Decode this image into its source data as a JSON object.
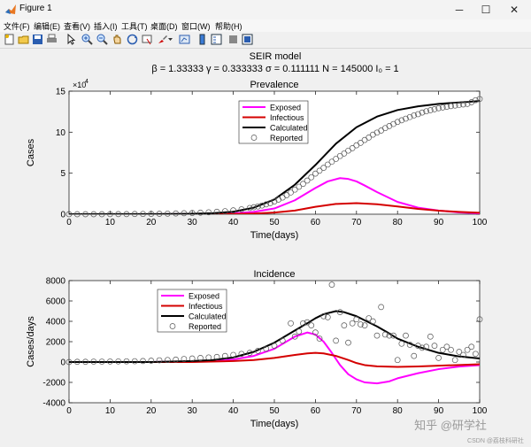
{
  "window": {
    "title": "Figure 1",
    "minimize_glyph": "─",
    "maximize_glyph": "☐",
    "close_glyph": "✕"
  },
  "menu": [
    "文件(F)",
    "编辑(E)",
    "查看(V)",
    "插入(I)",
    "工具(T)",
    "桌面(D)",
    "窗口(W)",
    "帮助(H)"
  ],
  "toolbar_icons": [
    "new-figure-icon",
    "open-file-icon",
    "save-icon",
    "print-icon",
    "select-arrow-icon",
    "zoom-in-icon",
    "zoom-out-icon",
    "pan-icon",
    "rotate-3d-icon",
    "data-cursor-icon",
    "brush-icon",
    "brush-dropdown-icon",
    "link-plot-icon",
    "insert-colorbar-icon",
    "insert-legend-icon",
    "hide-plot-tools-icon",
    "show-plot-tools-icon"
  ],
  "figure": {
    "title": "SEIR model",
    "subtitle": "β = 1.33333  γ = 0.333333  σ = 0.111111  N = 145000  I₀ = 1"
  },
  "watermark": {
    "text": "知乎 @研学社",
    "credit": "CSDN @荔枝科研社"
  },
  "colors": {
    "exposed": "#ff00ff",
    "infectious": "#d40000",
    "calculated": "#000000",
    "reported_marker": "#555555"
  },
  "chart_data": [
    {
      "type": "line",
      "title": "Prevalence",
      "xlabel": "Time(days)",
      "ylabel": "Cases",
      "y_exponent_label": "×10",
      "y_exponent": "4",
      "xlim": [
        0,
        100
      ],
      "ylim": [
        0,
        150000
      ],
      "x_ticks": [
        "0",
        "10",
        "20",
        "30",
        "40",
        "50",
        "60",
        "70",
        "80",
        "90",
        "100"
      ],
      "y_ticks": [
        "0",
        "5",
        "10",
        "15"
      ],
      "grid": false,
      "legend": "top-center",
      "series": [
        {
          "name": "Exposed",
          "style": "line",
          "color": "#ff00ff",
          "x": [
            0,
            10,
            20,
            30,
            35,
            40,
            45,
            50,
            55,
            60,
            63,
            66,
            68,
            70,
            72,
            75,
            80,
            85,
            90,
            95,
            100
          ],
          "y": [
            0,
            0,
            0,
            150,
            400,
            1100,
            2800,
            7000,
            17000,
            32000,
            40000,
            44000,
            43000,
            40000,
            35000,
            27000,
            15000,
            8000,
            4500,
            2200,
            1000
          ]
        },
        {
          "name": "Infectious",
          "style": "line",
          "color": "#d40000",
          "x": [
            0,
            30,
            40,
            45,
            50,
            55,
            60,
            65,
            70,
            75,
            80,
            85,
            90,
            95,
            100
          ],
          "y": [
            0,
            0,
            300,
            800,
            2000,
            4500,
            9000,
            12500,
            13500,
            12200,
            9500,
            6500,
            4300,
            2800,
            1800
          ]
        },
        {
          "name": "Calculated",
          "style": "line",
          "color": "#000000",
          "x": [
            0,
            20,
            30,
            35,
            40,
            45,
            50,
            55,
            60,
            65,
            70,
            75,
            80,
            85,
            90,
            95,
            100
          ],
          "y": [
            0,
            200,
            600,
            1200,
            3000,
            8000,
            18000,
            36000,
            60000,
            86000,
            106000,
            119000,
            127000,
            131500,
            134500,
            136300,
            138000
          ]
        },
        {
          "name": "Reported",
          "style": "marker",
          "color": "#555555",
          "x": [
            0,
            2,
            4,
            6,
            8,
            10,
            12,
            14,
            16,
            18,
            20,
            22,
            24,
            26,
            28,
            30,
            32,
            34,
            36,
            38,
            40,
            42,
            44,
            45,
            46,
            47,
            48,
            49,
            50,
            51,
            52,
            53,
            54,
            55,
            56,
            57,
            58,
            59,
            60,
            61,
            62,
            63,
            64,
            65,
            66,
            67,
            68,
            69,
            70,
            71,
            72,
            73,
            74,
            75,
            76,
            77,
            78,
            79,
            80,
            81,
            82,
            83,
            84,
            85,
            86,
            87,
            88,
            89,
            90,
            91,
            92,
            93,
            94,
            95,
            96,
            97,
            98,
            99,
            100
          ],
          "y": [
            1,
            5,
            10,
            20,
            40,
            70,
            110,
            160,
            230,
            320,
            430,
            560,
            720,
            920,
            1180,
            1500,
            1880,
            2350,
            2950,
            3700,
            4700,
            6000,
            7600,
            8500,
            9500,
            10600,
            12000,
            13500,
            15500,
            17800,
            20300,
            23200,
            26500,
            30000,
            33500,
            37000,
            41000,
            45000,
            49500,
            53000,
            56500,
            60500,
            64000,
            67500,
            71000,
            74000,
            77500,
            80500,
            84000,
            87000,
            90500,
            93500,
            97000,
            99500,
            102000,
            105000,
            107500,
            110000,
            112500,
            114500,
            116500,
            118500,
            120500,
            122000,
            124000,
            125500,
            126800,
            128000,
            129200,
            130200,
            131000,
            131800,
            132500,
            133200,
            133800,
            134500,
            136500,
            139000,
            140500
          ]
        }
      ]
    },
    {
      "type": "line",
      "title": "Incidence",
      "xlabel": "Time(days)",
      "ylabel": "Cases/days",
      "xlim": [
        0,
        100
      ],
      "ylim": [
        -4000,
        8000
      ],
      "x_ticks": [
        "0",
        "10",
        "20",
        "30",
        "40",
        "50",
        "60",
        "70",
        "80",
        "90",
        "100"
      ],
      "y_ticks": [
        "-4000",
        "-2000",
        "0",
        "2000",
        "4000",
        "6000",
        "8000"
      ],
      "grid": false,
      "legend": "top-left",
      "series": [
        {
          "name": "Exposed",
          "style": "line",
          "color": "#ff00ff",
          "x": [
            0,
            20,
            30,
            35,
            40,
            45,
            50,
            55,
            58,
            60,
            62,
            64,
            66,
            68,
            70,
            72,
            75,
            78,
            80,
            85,
            90,
            95,
            100
          ],
          "y": [
            0,
            0,
            50,
            100,
            250,
            600,
            1300,
            2500,
            2900,
            2700,
            2000,
            900,
            -300,
            -1200,
            -1700,
            -2000,
            -2100,
            -1900,
            -1600,
            -1100,
            -700,
            -450,
            -300
          ]
        },
        {
          "name": "Infectious",
          "style": "line",
          "color": "#d40000",
          "x": [
            0,
            30,
            40,
            45,
            50,
            55,
            58,
            60,
            62,
            65,
            68,
            70,
            72,
            75,
            80,
            85,
            90,
            95,
            100
          ],
          "y": [
            0,
            0,
            100,
            200,
            400,
            700,
            850,
            900,
            850,
            600,
            200,
            -100,
            -300,
            -420,
            -480,
            -430,
            -360,
            -290,
            -220
          ]
        },
        {
          "name": "Calculated",
          "style": "line",
          "color": "#000000",
          "x": [
            0,
            20,
            30,
            35,
            40,
            45,
            50,
            55,
            58,
            60,
            62,
            65,
            67,
            70,
            72,
            75,
            78,
            80,
            85,
            90,
            95,
            100
          ],
          "y": [
            0,
            0,
            100,
            200,
            450,
            1000,
            1900,
            3100,
            3800,
            4300,
            4700,
            5000,
            4900,
            4500,
            4100,
            3500,
            2800,
            2300,
            1500,
            900,
            550,
            350
          ]
        },
        {
          "name": "Reported",
          "style": "marker",
          "color": "#555555",
          "x": [
            0,
            2,
            4,
            6,
            8,
            10,
            12,
            14,
            16,
            18,
            20,
            22,
            24,
            26,
            28,
            30,
            32,
            34,
            36,
            38,
            40,
            42,
            44,
            46,
            48,
            50,
            52,
            54,
            55,
            56,
            57,
            58,
            59,
            60,
            61,
            62,
            63,
            64,
            65,
            66,
            67,
            68,
            69,
            70,
            71,
            72,
            73,
            74,
            75,
            76,
            77,
            78,
            79,
            80,
            81,
            82,
            83,
            84,
            85,
            86,
            87,
            88,
            89,
            90,
            91,
            92,
            93,
            94,
            95,
            96,
            97,
            98,
            99,
            100
          ],
          "y": [
            0,
            20,
            20,
            40,
            40,
            50,
            60,
            70,
            80,
            100,
            130,
            170,
            200,
            240,
            300,
            350,
            400,
            450,
            500,
            600,
            700,
            800,
            900,
            1100,
            1300,
            1600,
            2100,
            3800,
            2500,
            3000,
            3800,
            3900,
            3600,
            2900,
            2300,
            4500,
            4400,
            7600,
            2100,
            4900,
            3600,
            1900,
            3800,
            4200,
            3700,
            3600,
            4300,
            4000,
            2600,
            5400,
            2700,
            2600,
            2600,
            200,
            1800,
            2600,
            1700,
            600,
            1600,
            1400,
            1500,
            2500,
            1600,
            400,
            1200,
            1500,
            1200,
            200,
            1000,
            700,
            1200,
            1500,
            800,
            4200
          ]
        }
      ]
    }
  ]
}
